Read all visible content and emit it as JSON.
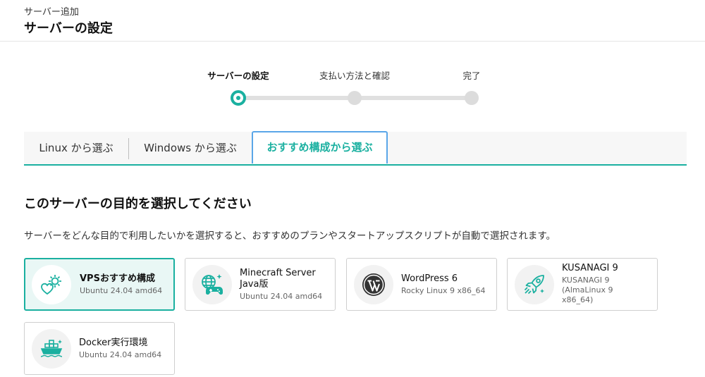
{
  "header": {
    "breadcrumb": "サーバー追加",
    "title": "サーバーの設定"
  },
  "steps": [
    {
      "label": "サーバーの設定",
      "state": "active"
    },
    {
      "label": "支払い方法と確認",
      "state": "pending"
    },
    {
      "label": "完了",
      "state": "pending"
    }
  ],
  "tabs": [
    {
      "label": "Linux から選ぶ",
      "active": false
    },
    {
      "label": "Windows から選ぶ",
      "active": false
    },
    {
      "label": "おすすめ構成から選ぶ",
      "active": true
    }
  ],
  "section": {
    "title": "このサーバーの目的を選択してください",
    "description": "サーバーをどんな目的で利用したいかを選択すると、おすすめのプランやスタートアップスクリプトが自動で選択されます。"
  },
  "cards": [
    {
      "name": "VPSおすすめ構成",
      "os": "Ubuntu 24.04 amd64",
      "icon": "heart-gear-icon",
      "selected": true
    },
    {
      "name": "Minecraft Server Java版",
      "os": "Ubuntu 24.04 amd64",
      "icon": "globe-gamepad-icon",
      "selected": false
    },
    {
      "name": "WordPress 6",
      "os": "Rocky Linux 9 x86_64",
      "icon": "wordpress-icon",
      "selected": false
    },
    {
      "name": "KUSANAGI 9",
      "os": "KUSANAGI 9 (AlmaLinux 9 x86_64)",
      "icon": "rocket-icon",
      "selected": false
    },
    {
      "name": "Docker実行環境",
      "os": "Ubuntu 24.04 amd64",
      "icon": "container-ship-icon",
      "selected": false
    }
  ],
  "colors": {
    "accent": "#1ab0a0",
    "tab_focus": "#5aa6e8",
    "selected_bg": "#e9f7f5"
  }
}
